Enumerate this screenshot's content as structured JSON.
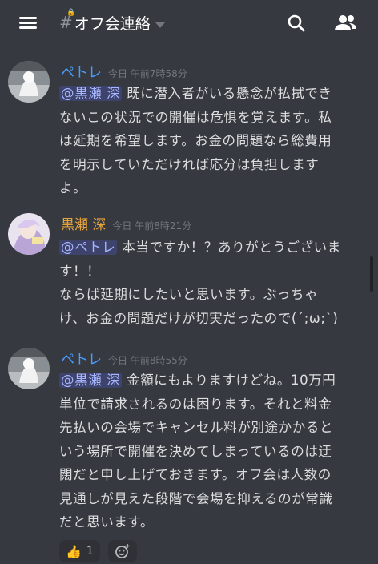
{
  "header": {
    "channel_name": "オフ会連絡",
    "hash": "#"
  },
  "messages": [
    {
      "author": "ペトレ",
      "author_color": "#4a9eff",
      "timestamp": "今日 午前7時58分",
      "mention": "@黒瀬 深",
      "lines": [
        "既に潜入者がいる懸念が払拭でき",
        "ないこの状況での開催は危惧を覚えます。私",
        "は延期を希望します。お金の問題なら総費用",
        "を明示していただければ応分は負担します",
        "よ。"
      ]
    },
    {
      "author": "黒瀬 深",
      "author_color": "#e6a33a",
      "timestamp": "今日 午前8時21分",
      "mention": "@ペトレ",
      "lines": [
        "本当ですか！？ありがとうございま",
        "す！！",
        "ならば延期にしたいと思います。ぶっちゃ",
        "け、お金の問題だけが切実だったので(´;ω;`)"
      ]
    },
    {
      "author": "ペトレ",
      "author_color": "#4a9eff",
      "timestamp": "今日 午前8時55分",
      "mention": "@黒瀬 深",
      "lines": [
        "金額にもよりますけどね。10万円",
        "単位で請求されるのは困ります。それと料金",
        "先払いの会場でキャンセル料が別途かかると",
        "いう場所で開催を決めてしまっているのは迂",
        "闊だと申し上げておきます。オフ会は人数の",
        "見通しが見えた段階で会場を抑えるのが常識",
        "だと思います。"
      ]
    }
  ],
  "reactions": [
    {
      "icon": "thumbs-up-icon",
      "emoji": "👍",
      "count": "1"
    },
    {
      "icon": "add-reaction-icon",
      "count": ""
    }
  ],
  "colors": {
    "background": "#36393f",
    "mention_bg": "#3c4270",
    "mention_text": "#a6b6ff"
  }
}
